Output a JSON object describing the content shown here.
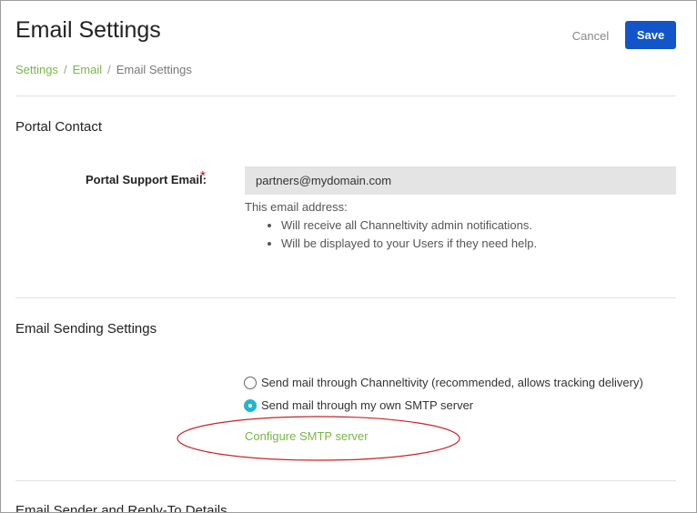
{
  "header": {
    "title": "Email Settings",
    "cancel_label": "Cancel",
    "save_label": "Save"
  },
  "breadcrumb": {
    "items": [
      "Settings",
      "Email",
      "Email Settings"
    ],
    "separator": "/"
  },
  "portal_contact": {
    "section_title": "Portal Contact",
    "field_label": "Portal Support Email:",
    "required_marker": "*",
    "email_value": "partners@mydomain.com",
    "help_intro": "This email address:",
    "help_items": [
      "Will receive all Channeltivity admin notifications.",
      "Will be displayed to your Users if they need help."
    ]
  },
  "email_sending": {
    "section_title": "Email Sending Settings",
    "options": [
      {
        "label": "Send mail through Channeltivity (recommended, allows tracking delivery)",
        "selected": false
      },
      {
        "label": "Send mail through my own SMTP server",
        "selected": true
      }
    ],
    "configure_link": "Configure SMTP server"
  },
  "sender_details": {
    "section_title": "Email Sender and Reply-To Details"
  },
  "colors": {
    "accent_link": "#7ab648",
    "save_button": "#1155c8",
    "radio_selected": "#22b5cf",
    "required": "#d0021b",
    "annotation": "#cc2222"
  }
}
